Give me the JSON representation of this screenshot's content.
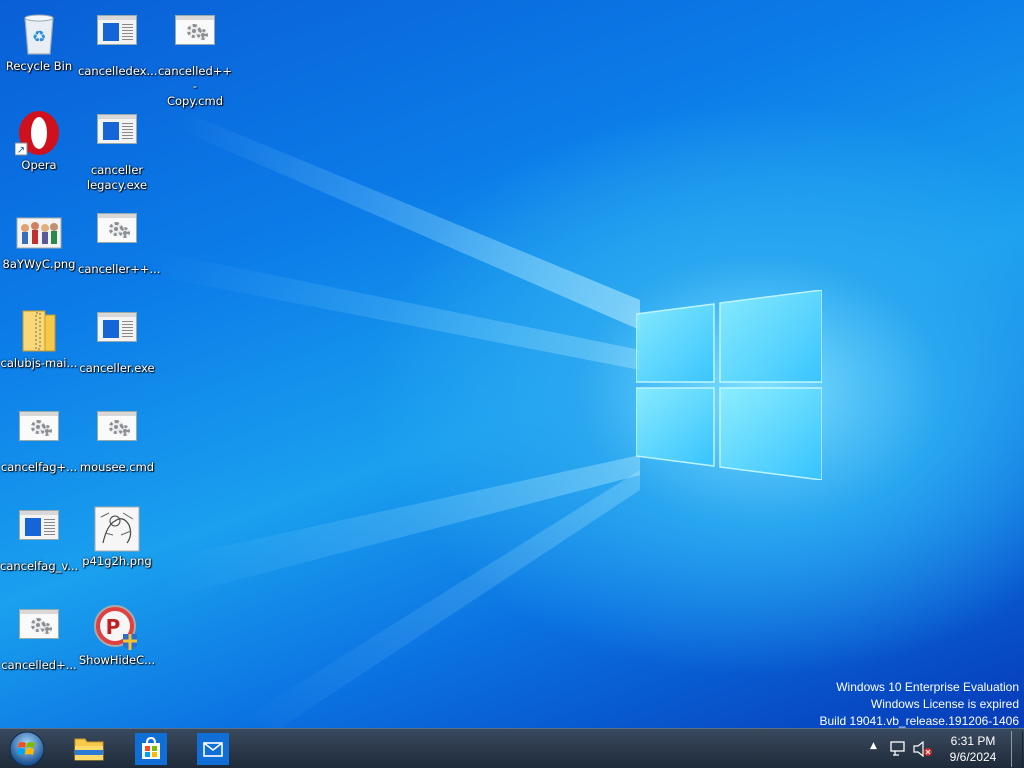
{
  "desktop": {
    "icons": [
      {
        "label": "Recycle Bin",
        "type": "recycle"
      },
      {
        "label": "cancelledex...",
        "type": "exe"
      },
      {
        "label": "cancelled++ -\nCopy.cmd",
        "type": "cmd"
      },
      {
        "label": "Opera",
        "type": "opera"
      },
      {
        "label": "canceller\nlegacy.exe",
        "type": "exe"
      },
      {
        "label": "8aYWyC.png",
        "type": "png-people"
      },
      {
        "label": "canceller++...",
        "type": "cmd"
      },
      {
        "label": "calubjs-mai...",
        "type": "zip"
      },
      {
        "label": "canceller.exe",
        "type": "exe"
      },
      {
        "label": "cancelfag+...",
        "type": "cmd"
      },
      {
        "label": "mousee.cmd",
        "type": "cmd"
      },
      {
        "label": "cancelfag_v...",
        "type": "exe"
      },
      {
        "label": "p41g2h.png",
        "type": "png-sketch"
      },
      {
        "label": "cancelled+...",
        "type": "cmd"
      },
      {
        "label": "ShowHideC...",
        "type": "showhide"
      }
    ]
  },
  "watermark": {
    "line1": "Windows 10 Enterprise Evaluation",
    "line2": "Windows License is expired",
    "line3": "Build 19041.vb_release.191206-1406"
  },
  "taskbar": {
    "apps": [
      {
        "name": "file-explorer"
      },
      {
        "name": "microsoft-store"
      },
      {
        "name": "mail"
      }
    ],
    "tray": {
      "chevron": "▲",
      "time": "6:31 PM",
      "date": "9/6/2024"
    }
  },
  "colors": {
    "desktop_blue": "#0b7be8",
    "taskbar": "#1e2a39",
    "opera_red": "#d0101c",
    "folder_yellow": "#f6c94a",
    "store_blue": "#0f6fd6"
  }
}
